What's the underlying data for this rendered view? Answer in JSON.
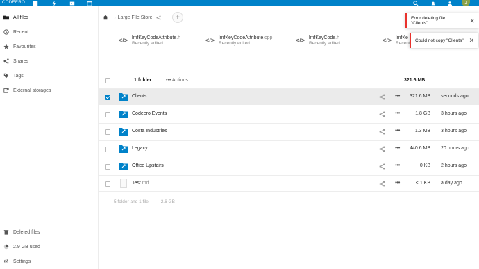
{
  "app": {
    "brand": "CODEERO",
    "avatar_initial": "J"
  },
  "sidebar": {
    "items": [
      {
        "label": "All files",
        "icon": "folder-icon"
      },
      {
        "label": "Recent",
        "icon": "clock-icon"
      },
      {
        "label": "Favourites",
        "icon": "star-icon"
      },
      {
        "label": "Shares",
        "icon": "share-icon"
      },
      {
        "label": "Tags",
        "icon": "tag-icon"
      },
      {
        "label": "External storages",
        "icon": "external-icon"
      }
    ],
    "bottom": [
      {
        "label": "Deleted files",
        "icon": "trash-icon"
      },
      {
        "label": "2.9 GB used",
        "icon": "pie-icon"
      },
      {
        "label": "Settings",
        "icon": "gear-icon"
      }
    ]
  },
  "breadcrumb": {
    "current": "Large File Store"
  },
  "recent": [
    {
      "name": "lmfKeyCodeAttribute",
      "ext": ".h",
      "sub": "Recently edited"
    },
    {
      "name": "lmfKeyCodeAttribute",
      "ext": ".cpp",
      "sub": "Recently edited"
    },
    {
      "name": "lmfKeyCode",
      "ext": ".h",
      "sub": "Recently edited"
    },
    {
      "name": "lmfKe",
      "ext": "",
      "sub": "Recently"
    }
  ],
  "toasts": [
    {
      "text": "Error deleting file \"Clients\"."
    },
    {
      "text": "Could not copy \"Clients\""
    }
  ],
  "table": {
    "header_count": "1 folder",
    "actions_label": "Actions",
    "header_size": "321.6 MB",
    "rows": [
      {
        "name": "Clients",
        "ext": "",
        "type": "folder",
        "size": "321.6 MB",
        "date": "seconds ago",
        "selected": true
      },
      {
        "name": "Codeero Events",
        "ext": "",
        "type": "folder",
        "size": "1.8 GB",
        "date": "3 hours ago",
        "selected": false
      },
      {
        "name": "Costa Industries",
        "ext": "",
        "type": "folder",
        "size": "1.3 MB",
        "date": "3 hours ago",
        "selected": false
      },
      {
        "name": "Legacy",
        "ext": "",
        "type": "folder",
        "size": "440.6 MB",
        "date": "20 hours ago",
        "selected": false
      },
      {
        "name": "Office Upstairs",
        "ext": "",
        "type": "folder",
        "size": "0 KB",
        "date": "2 hours ago",
        "selected": false
      },
      {
        "name": "Test",
        "ext": ".md",
        "type": "file",
        "size": "< 1 KB",
        "date": "a day ago",
        "selected": false
      }
    ],
    "summary_count": "5 folder and 1 file",
    "summary_size": "2.6 GB"
  },
  "colors": {
    "accent": "#0082c9",
    "error": "#e9322d",
    "folder": "#0082c9"
  }
}
